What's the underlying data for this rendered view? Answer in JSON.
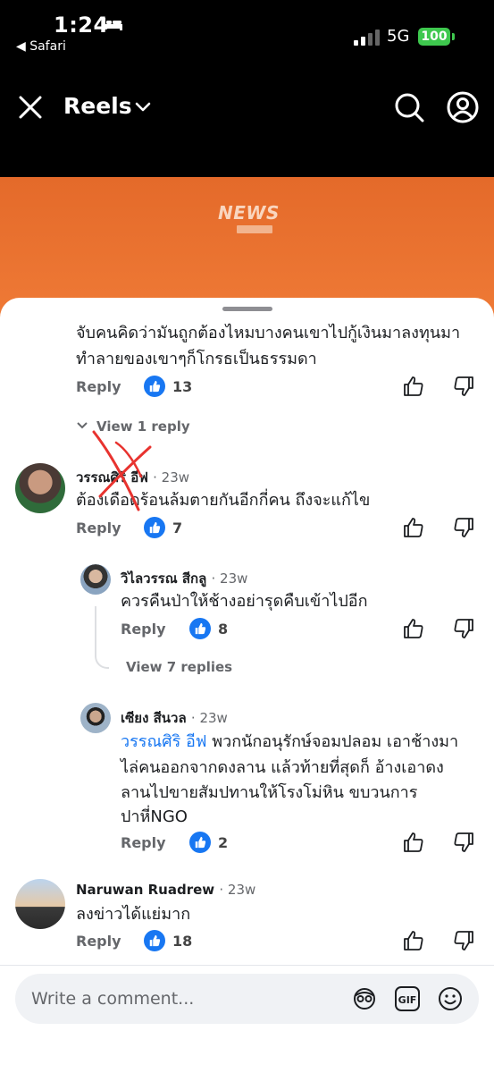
{
  "status": {
    "time": "1:24",
    "back_app": "◀ Safari",
    "network": "5G",
    "battery": "100"
  },
  "header": {
    "title": "Reels"
  },
  "video": {
    "logo_text": "NEWS"
  },
  "comments": [
    {
      "text_line1": "จับคนคิดว่ามันถูกต้องไหมบางคนเขาไปกู้เงินมาลงทุนมา",
      "text_line2": "ทำลายของเขาๆก็โกรธเป็นธรรมดา",
      "reply_label": "Reply",
      "likes": "13",
      "view_replies": "View 1 reply"
    },
    {
      "name": "วรรณศิริ อีฟ",
      "time": "· 23w",
      "text": "ต้องเดือดร้อนล้มตายกันอีกกี่คน ถึงจะแก้ไข",
      "reply_label": "Reply",
      "likes": "7"
    },
    {
      "name": "วิไลวรรณ สีกลู",
      "time": "· 23w",
      "text": "ควรคืนป่าให้ช้างอย่ารุดคืบเข้าไปอีก",
      "reply_label": "Reply",
      "likes": "8",
      "view_replies": "View 7 replies"
    },
    {
      "name": "เซียง สีนวล",
      "time": "· 23w",
      "mention": "วรรณศิริ อีฟ",
      "text_line1": " พวกนักอนุรักษ์จอมปลอม เอาช้างมา",
      "text_line2": "ไล่คนออกจากดงลาน  แล้วท้ายที่สุดก็  อ้างเอาดง",
      "text_line3": "ลานไปขายสัมปทานให้โรงโม่หิน ขบวนการ",
      "text_line4": "ปาหี่NGO",
      "reply_label": "Reply",
      "likes": "2"
    },
    {
      "name": "Naruwan Ruadrew",
      "time": "· 23w",
      "text": "ลงข่าวได้แย่มาก",
      "reply_label": "Reply",
      "likes": "18"
    }
  ],
  "composer": {
    "placeholder": "Write a comment..."
  },
  "colors": {
    "accent": "#1877f2",
    "video": "#e96f30",
    "battery": "#3ec84e"
  }
}
